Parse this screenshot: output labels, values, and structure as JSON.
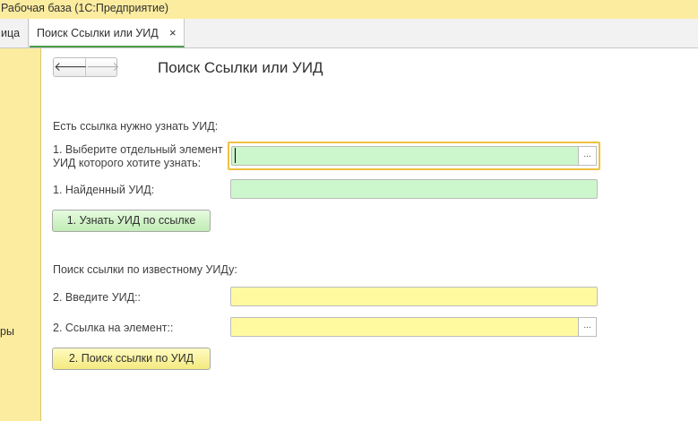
{
  "window": {
    "title": "Рабочая база  (1С:Предприятие)"
  },
  "tabs": {
    "prev_fragment": "ица",
    "active": {
      "label": "Поиск Ссылки или УИД",
      "close_glyph": "×"
    }
  },
  "sidebar": {
    "fragment": "ры"
  },
  "nav": {
    "back_glyph": "🡐",
    "forward_glyph": "🡒"
  },
  "form": {
    "title": "Поиск Ссылки или УИД",
    "section1": {
      "heading": "Есть ссылка нужно узнать УИД:",
      "select_label_line1": "1. Выберите отдельный элемент",
      "select_label_line2": "УИД которого хотите узнать:",
      "select_value": "",
      "select_button": "...",
      "found_label": "1. Найденный УИД:",
      "found_value": "",
      "action_button": "1. Узнать УИД по ссылке"
    },
    "section2": {
      "heading": "Поиск ссылки по известному УИДу:",
      "uid_label": "2. Введите УИД::",
      "uid_value": "",
      "ref_label": "2. Ссылка на элемент::",
      "ref_value": "",
      "ref_button": "...",
      "action_button": "2. Поиск ссылки по УИД"
    }
  },
  "colors": {
    "title_bar": "#fbeca0",
    "green_field": "#ccf7cc",
    "yellow_field": "#fffaa0",
    "focus_border": "#f0c040",
    "active_tab_underline": "#4a9c4a"
  }
}
